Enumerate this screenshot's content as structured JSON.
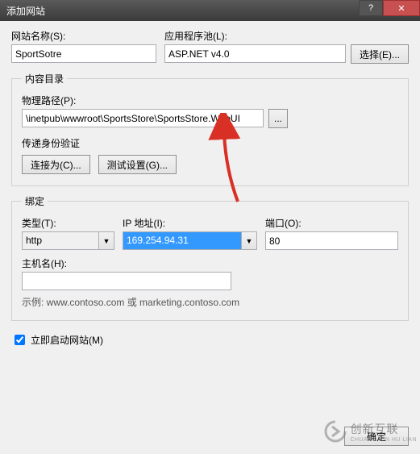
{
  "window": {
    "title": "添加网站"
  },
  "site": {
    "name_label": "网站名称(S):",
    "name_value": "SportSotre",
    "pool_label": "应用程序池(L):",
    "pool_value": "ASP.NET v4.0",
    "select_btn": "选择(E)..."
  },
  "content": {
    "legend": "内容目录",
    "path_label": "物理路径(P):",
    "path_value": "\\inetpub\\wwwroot\\SportsStore\\SportsStore.WebUI",
    "browse_btn": "...",
    "auth_label": "传递身份验证",
    "connect_btn": "连接为(C)...",
    "test_btn": "测试设置(G)..."
  },
  "binding": {
    "legend": "绑定",
    "type_label": "类型(T):",
    "type_value": "http",
    "ip_label": "IP 地址(I):",
    "ip_value": "169.254.94.31",
    "port_label": "端口(O):",
    "port_value": "80",
    "host_label": "主机名(H):",
    "host_value": "",
    "hint": "示例: www.contoso.com 或 marketing.contoso.com"
  },
  "start": {
    "label": "立即启动网站(M)"
  },
  "footer": {
    "ok": "确定"
  },
  "watermark": {
    "brand": "创新互联",
    "sub": "CHUANG XIN HU LIAN"
  }
}
